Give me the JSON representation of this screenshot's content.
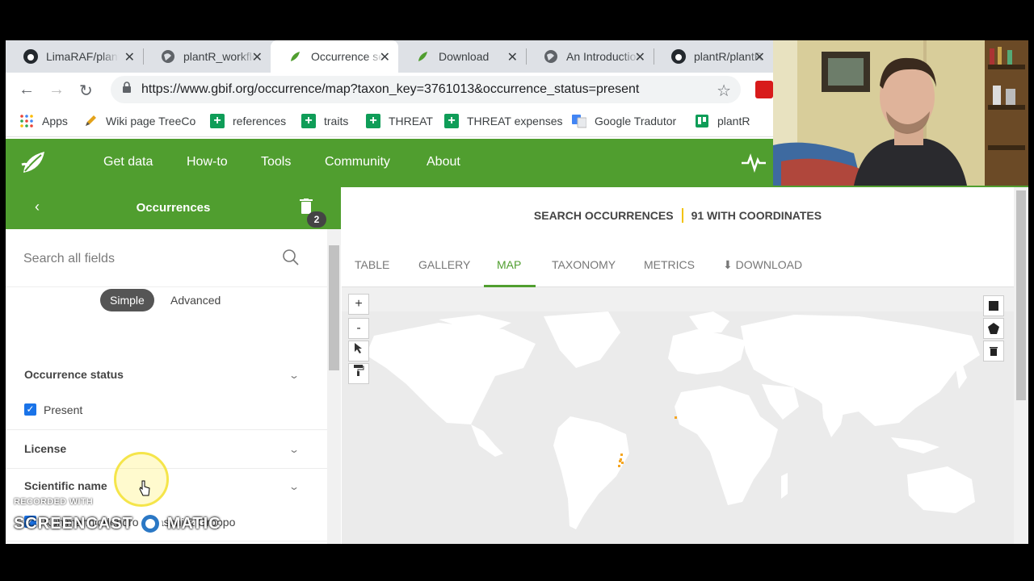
{
  "browser": {
    "tabs": [
      {
        "title": "LimaRAF/plantR",
        "icon": "github-icon",
        "active": false
      },
      {
        "title": "plantR_workflow",
        "icon": "globe-icon",
        "active": false
      },
      {
        "title": "Occurrence search",
        "icon": "gbif-icon",
        "active": true
      },
      {
        "title": "Download",
        "icon": "gbif-icon",
        "active": false
      },
      {
        "title": "An Introduction",
        "icon": "globe-icon",
        "active": false
      },
      {
        "title": "plantR/plantR",
        "icon": "github-icon",
        "active": false
      }
    ],
    "close_glyph": "✕",
    "url": "https://www.gbif.org/occurrence/map?taxon_key=3761013&occurrence_status=present",
    "bookmarks": [
      {
        "label": "Apps",
        "icon": "apps-grid-icon"
      },
      {
        "label": "Wiki page TreeCo",
        "icon": "pencil-icon"
      },
      {
        "label": "references",
        "icon": "google-sheets-icon"
      },
      {
        "label": "traits",
        "icon": "google-sheets-icon"
      },
      {
        "label": "THREAT",
        "icon": "google-sheets-icon"
      },
      {
        "label": "THREAT expenses",
        "icon": "google-sheets-icon"
      },
      {
        "label": "Google Tradutor",
        "icon": "google-translate-icon"
      },
      {
        "label": "plantR",
        "icon": "trello-icon"
      }
    ]
  },
  "gbif": {
    "brand_color": "#509e2f",
    "nav": [
      "Get data",
      "How-to",
      "Tools",
      "Community",
      "About"
    ]
  },
  "filters": {
    "title": "Occurrences",
    "badge_count": "2",
    "search_placeholder": "Search all fields",
    "mode_simple": "Simple",
    "mode_advanced": "Advanced",
    "sections": [
      {
        "title": "Occurrence status",
        "checked": [
          "Present"
        ]
      },
      {
        "title": "License",
        "checked": []
      },
      {
        "title": "Scientific name",
        "checked": [
          "Kuhlmanniodendron Fiaschi & Groppo"
        ]
      }
    ]
  },
  "results": {
    "summary_left": "SEARCH OCCURRENCES",
    "summary_right": "91 WITH COORDINATES",
    "tabs": [
      "TABLE",
      "GALLERY",
      "MAP",
      "TAXONOMY",
      "METRICS",
      "DOWNLOAD"
    ],
    "active_tab": "MAP",
    "map_controls": [
      "+",
      "-"
    ]
  },
  "overlay": {
    "recorded_with": "RECORDED WITH",
    "screencast": "SCREENCAST",
    "matic": "MATIC"
  }
}
